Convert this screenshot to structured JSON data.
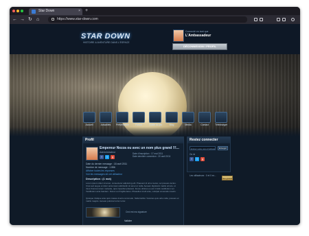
{
  "browser": {
    "tab_title": "Star Down",
    "tab_close": "×",
    "new_tab": "+",
    "back": "←",
    "forward": "→",
    "reload": "↻",
    "home": "⌂",
    "url": "https://www.star-down.com"
  },
  "header": {
    "logo": "STAR DOWN",
    "tagline": "HISTOIRE & AVENTURE DANS L'ESPACE",
    "user_small": "Connecté en tant que",
    "user_name": "L'Ambassadeur",
    "user_button": "DÉCONNEXION / PROFIL"
  },
  "menu": [
    {
      "label": "Accueil",
      "icon": "home-icon"
    },
    {
      "label": "Actualités",
      "icon": "news-icon"
    },
    {
      "label": "Présentation",
      "icon": "presentation-icon"
    },
    {
      "label": "Forum",
      "icon": "forum-icon"
    },
    {
      "label": "Guide du jeu",
      "icon": "guide-icon"
    },
    {
      "label": "Blog",
      "icon": "blog-icon"
    },
    {
      "label": "Media",
      "icon": "media-icon"
    },
    {
      "label": "Contact",
      "icon": "contact-icon"
    },
    {
      "label": "Télécharger",
      "icon": "download-icon"
    }
  ],
  "profile": {
    "heading": "Profil",
    "title": "Empereur Nezza ou avec un nom plus grand !!!...",
    "role": "Administrateur",
    "meta1": "Date d'inscription : 17 mai 2011",
    "meta2": "Date dernière connexion : 20 avril 2011",
    "line1": "Date du dernier message : 18 avril 2011",
    "line2": "Nombre de message : 1 856",
    "link1": "Afficher toutes les réponses",
    "link2": "Voir les messages de cet utilisateur",
    "about_title": "Description : (1 mot)",
    "para1": "Lorem ipsum dolor sit amet, consectetur adipiscing elit. Praesent id urna metus, vel posuere lectus. Cras sed augue et dolor accumsan sollicitudin sit amet ut nulla. Aenean dignissim mattis ornare, ut risus rhoncus lorem molestie, quis imperdiet placerat. Fusce ultrices eu est in felis vestibulum vel. Vestibulum ante bandem. Donec eu fringilla lacus. Phasellus id elit ante, volutpat venenatis mauris.",
    "para2": "Quisque tristique ante quis massa viverra commodo. Nulla facilisi. Vivamus quis odio nulla, posuere et mattis magnis. Aenean pulvinar tortor tortor.",
    "caption": "Ceci est ma signature",
    "valider": "Valider"
  },
  "sidebar": {
    "heading": "Restez connecter",
    "input_placeholder": "Entrez votre nom d'utilisateur",
    "button": "Envoyer",
    "ou": "Ou ici",
    "note": "Les utilisateurs : 0 et 0 ex...",
    "gold_button": "Jeu gratuit"
  }
}
